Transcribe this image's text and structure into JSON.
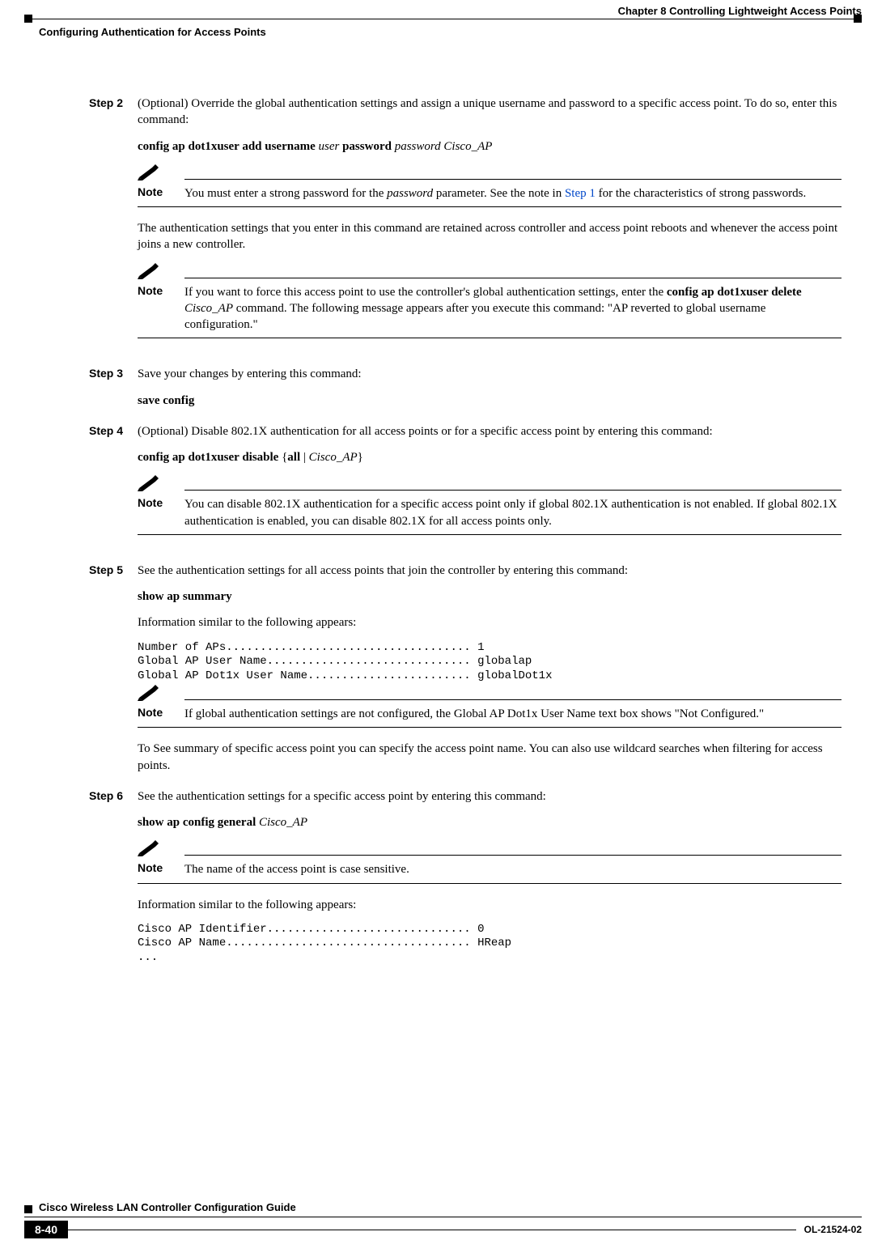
{
  "header": {
    "chapter": "Chapter 8      Controlling Lightweight Access Points",
    "section": "Configuring Authentication for Access Points"
  },
  "steps": {
    "step2": {
      "label": "Step 2",
      "para1_a": "(Optional) Override the global authentication settings and assign a unique username and password to a specific access point. To do so, enter this command:",
      "cmd_a": "config ap dot1xuser add username",
      "cmd_arg_user": " user ",
      "cmd_b": "password",
      "cmd_arg_pw": " password Cisco_AP",
      "note1": {
        "label": "Note",
        "text_a": "You must enter a strong password for the ",
        "text_i": "password",
        "text_b": " parameter. See the note in ",
        "link": "Step 1",
        "text_c": " for the characteristics of strong passwords."
      },
      "para2": "The authentication settings that you enter in this command are retained across controller and access point reboots and whenever the access point joins a new controller.",
      "note2": {
        "label": "Note",
        "text_a": "If you want to force this access point to use the controller's global authentication settings, enter the ",
        "bold": "config ap dot1xuser delete",
        "ital": " Cisco_AP",
        "text_b": " command. The following message appears after you execute this command: \"AP reverted to global username configuration.\""
      }
    },
    "step3": {
      "label": "Step 3",
      "para": "Save your changes by entering this command:",
      "cmd": "save config"
    },
    "step4": {
      "label": "Step 4",
      "para": "(Optional) Disable 802.1X authentication for all access points or for a specific access point by entering this command:",
      "cmd_a": "config ap dot1xuser disable ",
      "brace_open": "{",
      "cmd_all": "all",
      "pipe": " | ",
      "cmd_arg": "Cisco_AP",
      "brace_close": "}",
      "note": {
        "label": "Note",
        "text": "You can disable 802.1X authentication for a specific access point only if global 802.1X authentication is not enabled. If global 802.1X authentication is enabled, you can disable 802.1X for all access points only."
      }
    },
    "step5": {
      "label": "Step 5",
      "para1": "See the authentication settings for all access points that join the controller by entering this command:",
      "cmd": "show ap summary",
      "para2": "Information similar to the following appears:",
      "output": "Number of APs.................................... 1\nGlobal AP User Name.............................. globalap\nGlobal AP Dot1x User Name........................ globalDot1x",
      "note": {
        "label": "Note",
        "text": "If global authentication settings are not configured, the Global AP Dot1x User Name text box shows \"Not Configured.\""
      },
      "para3": "To See summary of specific access point you can specify the access point name. You can also use wildcard searches when filtering for access points."
    },
    "step6": {
      "label": "Step 6",
      "para1": "See the authentication settings for a specific access point by entering this command:",
      "cmd": "show ap config general ",
      "cmd_arg": "Cisco_AP",
      "note": {
        "label": "Note",
        "text": "The name of the access point is case sensitive."
      },
      "para2": "Information similar to the following appears:",
      "output": "Cisco AP Identifier.............................. 0\nCisco AP Name.................................... HReap\n..."
    }
  },
  "footer": {
    "title": "Cisco Wireless LAN Controller Configuration Guide",
    "page": "8-40",
    "doc": "OL-21524-02"
  }
}
